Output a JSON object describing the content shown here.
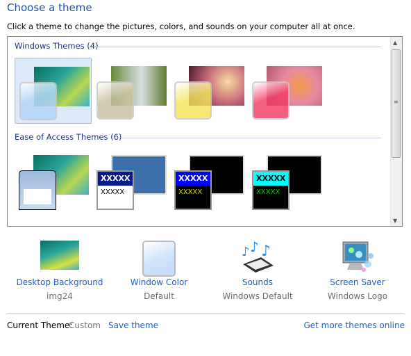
{
  "title": "Choose a theme",
  "description": "Click a theme to change the pictures, colors, and sounds on your computer all at once.",
  "groups": [
    {
      "label": "Windows Themes (4)",
      "items": [
        {
          "name": "windows-7",
          "selected": true,
          "glass": "#b4d4f8",
          "wallpaper": "linear-gradient(135deg,#0b6e64,#2aa59a 40%,#b8d650 70%,#3bb0c8)"
        },
        {
          "name": "landscapes",
          "selected": false,
          "glass": "#c9c0a0",
          "wallpaper": "linear-gradient(90deg,#6a8a3a,#d9dfe2 55%,#5f7a2e)"
        },
        {
          "name": "nature",
          "selected": false,
          "glass": "#f4e45a",
          "wallpaper": "radial-gradient(circle at 70% 40%,#f6dca0,#c86a7a 45%,#3a0e22)"
        },
        {
          "name": "flowers",
          "selected": false,
          "glass": "#f03c64",
          "wallpaper": "radial-gradient(circle at 60% 50%,#f39a4a,#e88aa0 45%,#b05a70)"
        }
      ]
    },
    {
      "label": "Ease of Access Themes (6)",
      "items": [
        {
          "name": "windows-7-basic",
          "sample1": "",
          "sample2": ""
        },
        {
          "name": "windows-classic",
          "sample1": "XXXXX",
          "sample2": "XXXXX",
          "c1bg": "#0a1a8a",
          "c1fg": "#ffffff",
          "c2fg": "#000000",
          "bodybg": "#ffffff",
          "wp": "#3d6fa8"
        },
        {
          "name": "high-contrast-1",
          "sample1": "XXXXX",
          "sample2": "XXXXX",
          "c1bg": "#0000ff",
          "c1fg": "#ffffff",
          "c2fg": "#d8d800",
          "bodybg": "#000000",
          "wp": "#000000"
        },
        {
          "name": "high-contrast-2",
          "sample1": "XXXXX",
          "sample2": "XXXXX",
          "c1bg": "#00ffff",
          "c1fg": "#000000",
          "c2fg": "#00d000",
          "bodybg": "#000000",
          "wp": "#000000"
        }
      ]
    }
  ],
  "options": [
    {
      "label": "Desktop Background",
      "value": "img24",
      "icon": "desktop-background-icon"
    },
    {
      "label": "Window Color",
      "value": "Default",
      "icon": "window-color-icon"
    },
    {
      "label": "Sounds",
      "value": "Windows Default",
      "icon": "sounds-icon"
    },
    {
      "label": "Screen Saver",
      "value": "Windows Logo",
      "icon": "screen-saver-icon"
    }
  ],
  "footer": {
    "current_label": "Current Theme:",
    "current_value": "Custom",
    "save": "Save theme",
    "more": "Get more themes online"
  },
  "colors": {
    "link": "#1e5fcc",
    "title": "#1e4fb4",
    "selection": "#dbe9fb"
  }
}
